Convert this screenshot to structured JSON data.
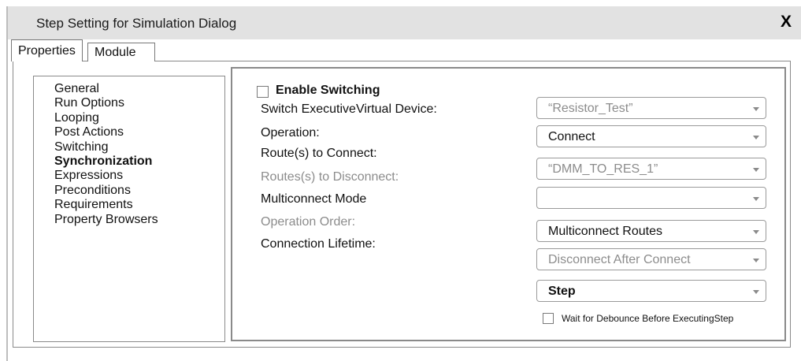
{
  "window": {
    "title": "Step Setting for Simulation Dialog",
    "close_label": "X"
  },
  "tabs": [
    {
      "label": "Properties",
      "active": true
    },
    {
      "label": "Module",
      "active": false
    }
  ],
  "nav": {
    "items": [
      "General",
      "Run Options",
      "Looping",
      "Post Actions",
      "Switching",
      "Synchronization",
      "Expressions",
      "Preconditions",
      "Requirements",
      "Property Browsers"
    ],
    "active_index": 5
  },
  "content": {
    "enable_switching": {
      "label": "Enable Switching",
      "checked": false
    },
    "labels": {
      "switch_executive": "Switch ExecutiveVirtual Device:",
      "operation": "Operation:",
      "routes_connect": "Route(s) to Connect:",
      "routes_disconnect": "Routes(s) to Disconnect:",
      "multiconnect_mode": "Multiconnect Mode",
      "operation_order": "Operation Order:",
      "connection_lifetime": "Connection Lifetime:"
    },
    "dropdowns": {
      "switch_executive": "“Resistor_Test”",
      "operation": "Connect",
      "routes_connect": "“DMM_TO_RES_1”",
      "multiconnect_mode": "",
      "operation_order": "Multiconnect Routes",
      "connection_lifetime": "Disconnect After Connect",
      "step": "Step"
    },
    "wait_debounce": {
      "label": "Wait for Debounce Before ExecutingStep",
      "checked": false
    }
  }
}
